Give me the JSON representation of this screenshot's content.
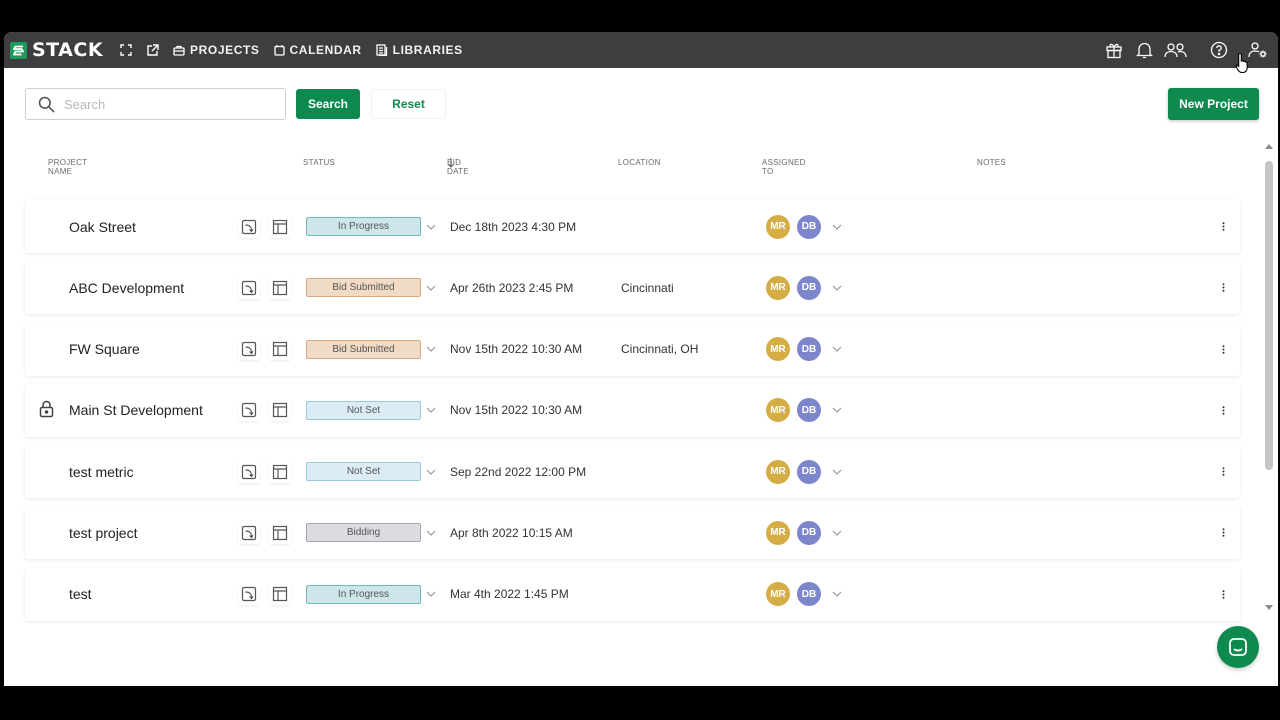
{
  "app": {
    "brand": "STACK",
    "nav": [
      {
        "label": "PROJECTS",
        "icon": "briefcase-icon"
      },
      {
        "label": "CALENDAR",
        "icon": "calendar-icon"
      },
      {
        "label": "LIBRARIES",
        "icon": "library-icon"
      }
    ]
  },
  "toolbar": {
    "search_placeholder": "Search",
    "search_value": "",
    "search_label": "Search",
    "reset_label": "Reset",
    "new_project_label": "New Project"
  },
  "table": {
    "headers": {
      "name": "PROJECT NAME",
      "status": "STATUS",
      "bid_date": "BID DATE",
      "location": "LOCATION",
      "assigned": "ASSIGNED TO",
      "notes": "NOTES"
    },
    "sort": {
      "column": "bid_date",
      "direction": "descending"
    },
    "rows": [
      {
        "name": "Oak Street",
        "status": "In Progress",
        "bid_date": "Dec 18th 2023 4:30 PM",
        "location": "",
        "assignees": [
          "MR",
          "DB"
        ],
        "locked": false
      },
      {
        "name": "ABC Development",
        "status": "Bid Submitted",
        "bid_date": "Apr 26th 2023 2:45 PM",
        "location": "Cincinnati",
        "assignees": [
          "MR",
          "DB"
        ],
        "locked": false
      },
      {
        "name": "FW Square",
        "status": "Bid Submitted",
        "bid_date": "Nov 15th 2022 10:30 AM",
        "location": "Cincinnati, OH",
        "assignees": [
          "MR",
          "DB"
        ],
        "locked": false
      },
      {
        "name": "Main St Development",
        "status": "Not Set",
        "bid_date": "Nov 15th 2022 10:30 AM",
        "location": "",
        "assignees": [
          "MR",
          "DB"
        ],
        "locked": true
      },
      {
        "name": "test metric",
        "status": "Not Set",
        "bid_date": "Sep 22nd 2022 12:00 PM",
        "location": "",
        "assignees": [
          "MR",
          "DB"
        ],
        "locked": false
      },
      {
        "name": "test project",
        "status": "Bidding",
        "bid_date": "Apr 8th 2022 10:15 AM",
        "location": "",
        "assignees": [
          "MR",
          "DB"
        ],
        "locked": false
      },
      {
        "name": "test",
        "status": "In Progress",
        "bid_date": "Mar 4th 2022 1:45 PM",
        "location": "",
        "assignees": [
          "MR",
          "DB"
        ],
        "locked": false
      }
    ]
  },
  "colors": {
    "brand_green": "#0f8a4f",
    "topbar": "#3e3e40",
    "avatar_mr": "#d4ae45",
    "avatar_db": "#7d85cb"
  }
}
